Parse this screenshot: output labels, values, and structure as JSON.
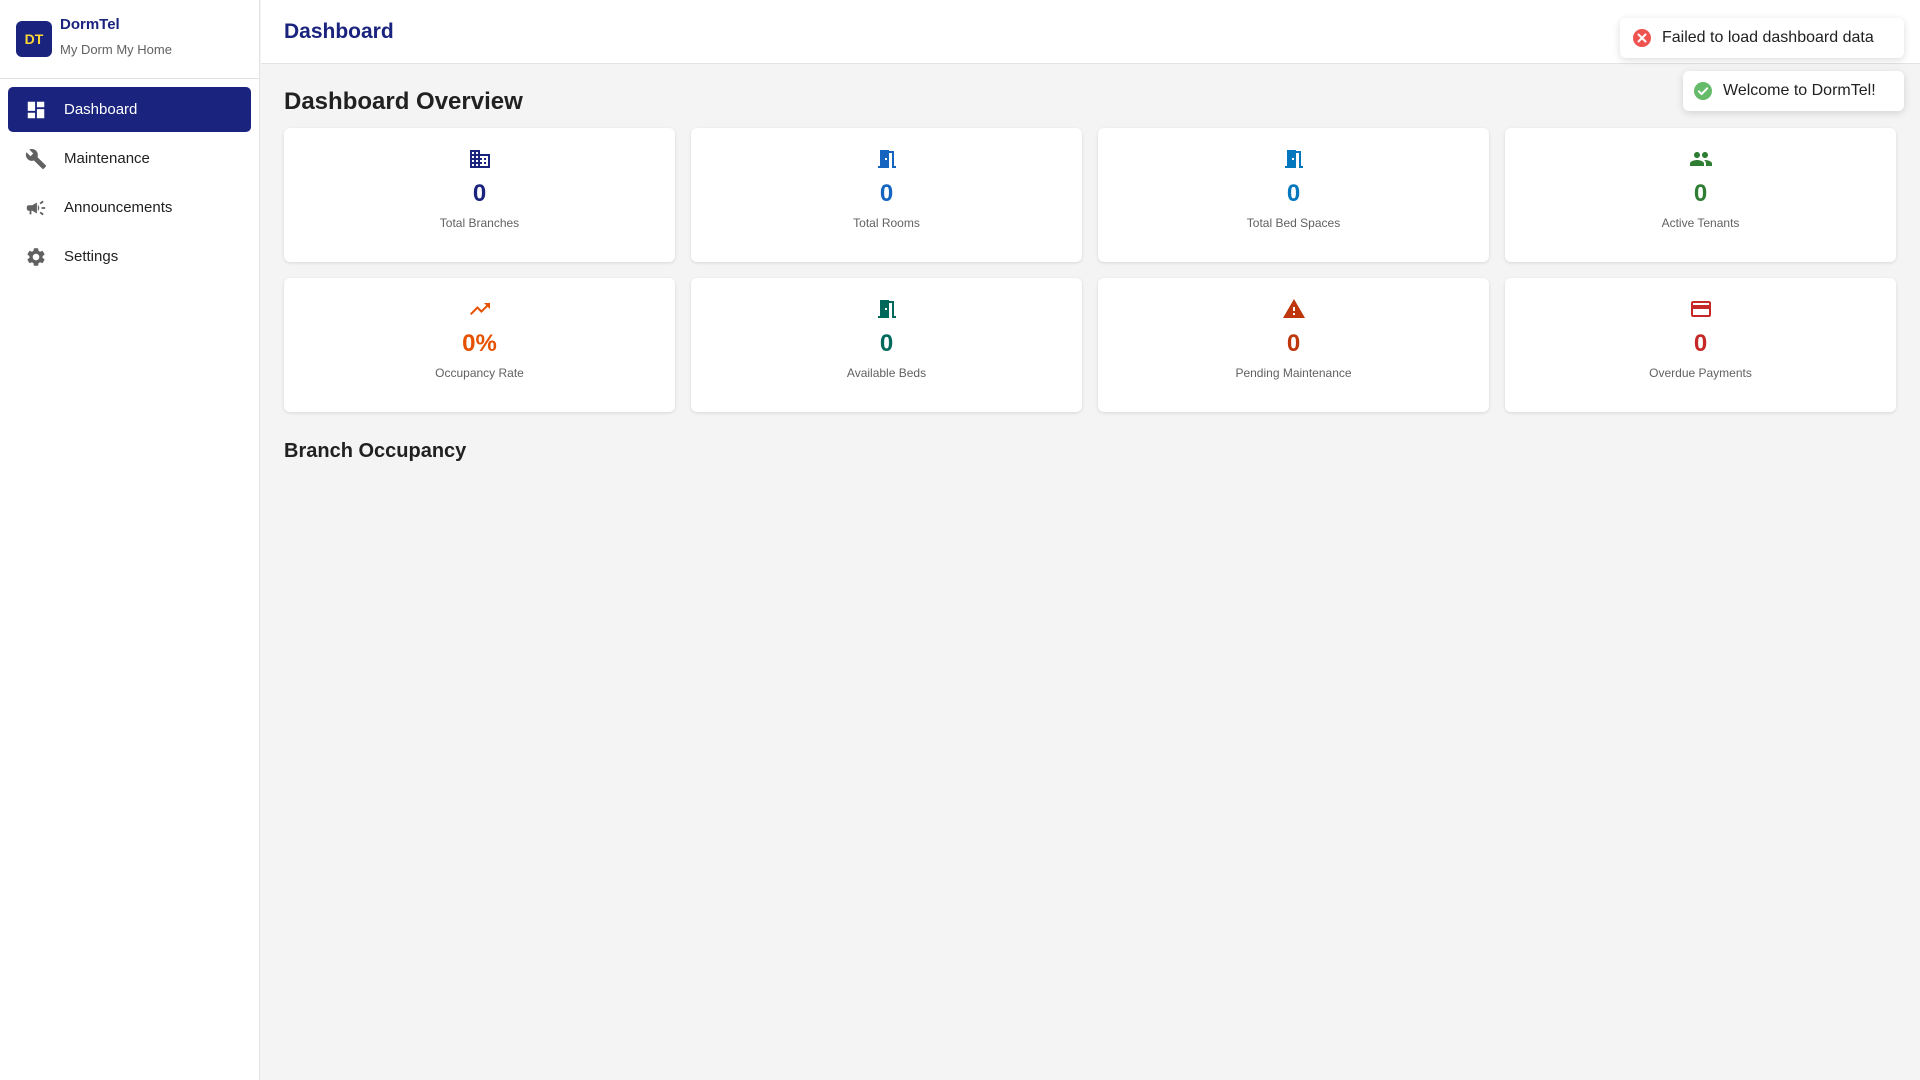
{
  "app": {
    "logo_text": "DT",
    "name": "DormTel",
    "tagline": "My Dorm My Home"
  },
  "sidebar": {
    "items": [
      {
        "label": "Dashboard",
        "icon": "dashboard-icon",
        "active": true
      },
      {
        "label": "Maintenance",
        "icon": "wrench-icon",
        "active": false
      },
      {
        "label": "Announcements",
        "icon": "megaphone-icon",
        "active": false
      },
      {
        "label": "Settings",
        "icon": "gear-icon",
        "active": false
      }
    ]
  },
  "header": {
    "title": "Dashboard"
  },
  "overview": {
    "title": "Dashboard Overview",
    "cards": [
      {
        "label": "Total Branches",
        "value": "0",
        "icon": "building-icon",
        "color": "#1a237e"
      },
      {
        "label": "Total Rooms",
        "value": "0",
        "icon": "door-icon",
        "color": "#1565c0"
      },
      {
        "label": "Total Bed Spaces",
        "value": "0",
        "icon": "door-icon",
        "color": "#0277bd"
      },
      {
        "label": "Active Tenants",
        "value": "0",
        "icon": "people-icon",
        "color": "#2e7d32"
      },
      {
        "label": "Occupancy Rate",
        "value": "0%",
        "icon": "trending-up-icon",
        "color": "#e65100"
      },
      {
        "label": "Available Beds",
        "value": "0",
        "icon": "door-icon",
        "color": "#00695c"
      },
      {
        "label": "Pending Maintenance",
        "value": "0",
        "icon": "warning-icon",
        "color": "#bf360c"
      },
      {
        "label": "Overdue Payments",
        "value": "0",
        "icon": "credit-card-icon",
        "color": "#c62828"
      }
    ]
  },
  "branch_occupancy": {
    "title": "Branch Occupancy"
  },
  "toasts": {
    "error": {
      "message": "Failed to load dashboard data",
      "color": "#ef5350"
    },
    "success": {
      "message": "Welcome to DormTel!",
      "color": "#66bb6a"
    }
  }
}
